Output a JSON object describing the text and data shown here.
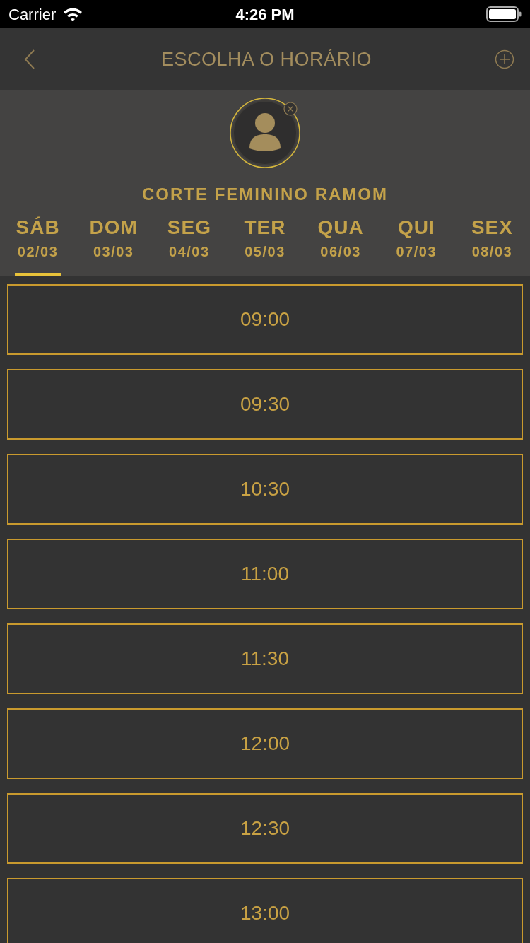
{
  "status_bar": {
    "carrier": "Carrier",
    "time": "4:26 PM"
  },
  "nav": {
    "title": "ESCOLHA O HORÁRIO"
  },
  "service": {
    "name": "CORTE FEMININO RAMOM"
  },
  "days": [
    {
      "weekday": "SÁB",
      "date": "02/03",
      "selected": true
    },
    {
      "weekday": "DOM",
      "date": "03/03",
      "selected": false
    },
    {
      "weekday": "SEG",
      "date": "04/03",
      "selected": false
    },
    {
      "weekday": "TER",
      "date": "05/03",
      "selected": false
    },
    {
      "weekday": "QUA",
      "date": "06/03",
      "selected": false
    },
    {
      "weekday": "QUI",
      "date": "07/03",
      "selected": false
    },
    {
      "weekday": "SEX",
      "date": "08/03",
      "selected": false
    }
  ],
  "slots": [
    {
      "time": "09:00"
    },
    {
      "time": "09:30"
    },
    {
      "time": "10:30"
    },
    {
      "time": "11:00"
    },
    {
      "time": "11:30"
    },
    {
      "time": "12:00"
    },
    {
      "time": "12:30"
    },
    {
      "time": "13:00"
    }
  ]
}
